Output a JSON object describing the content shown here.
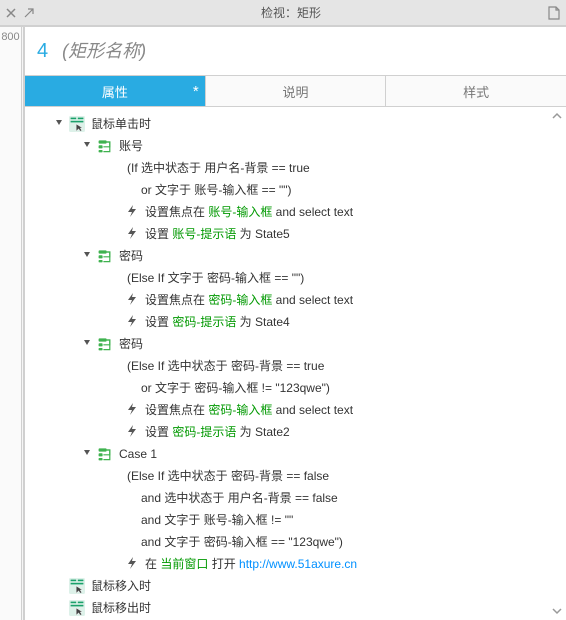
{
  "titlebar": {
    "title": "检视：矩形",
    "ruler": "800"
  },
  "header": {
    "index": "4",
    "namePlaceholder": "(矩形名称)"
  },
  "tabs": {
    "items": [
      "属性",
      "说明",
      "样式"
    ],
    "activeIndex": 0,
    "dirtyMark": "*"
  },
  "events": {
    "click": {
      "label": "鼠标单击时",
      "cases": [
        {
          "name": "账号",
          "cond": [
            "(If 选中状态于 用户名-背景 == true",
            "or 文字于 账号-输入框 == \"\")"
          ],
          "actions": [
            {
              "pre": "设置焦点在 ",
              "g": "账号-输入框",
              "post": " and select text"
            },
            {
              "pre": "设置 ",
              "g": "账号-提示语",
              "post": " 为 State5"
            }
          ]
        },
        {
          "name": "密码",
          "cond": [
            "(Else If 文字于 密码-输入框 == \"\")"
          ],
          "actions": [
            {
              "pre": "设置焦点在 ",
              "g": "密码-输入框",
              "post": " and select text"
            },
            {
              "pre": "设置 ",
              "g": "密码-提示语",
              "post": " 为 State4"
            }
          ]
        },
        {
          "name": "密码",
          "cond": [
            "(Else If 选中状态于 密码-背景 == true",
            "or 文字于 密码-输入框 != \"123qwe\")"
          ],
          "actions": [
            {
              "pre": "设置焦点在 ",
              "g": "密码-输入框",
              "post": " and select text"
            },
            {
              "pre": "设置 ",
              "g": "密码-提示语",
              "post": " 为 State2"
            }
          ]
        },
        {
          "name": "Case 1",
          "cond": [
            "(Else If 选中状态于 密码-背景 == false",
            "and 选中状态于 用户名-背景 == false",
            "and 文字于 账号-输入框 != \"\"",
            "and 文字于 密码-输入框 == \"123qwe\")"
          ],
          "actions": [
            {
              "pre": "在 ",
              "g": "当前窗口",
              "post": " 打开 ",
              "url": "http://www.51axure.cn"
            }
          ]
        }
      ]
    },
    "mouseIn": {
      "label": "鼠标移入时"
    },
    "mouseOut": {
      "label": "鼠标移出时"
    }
  }
}
